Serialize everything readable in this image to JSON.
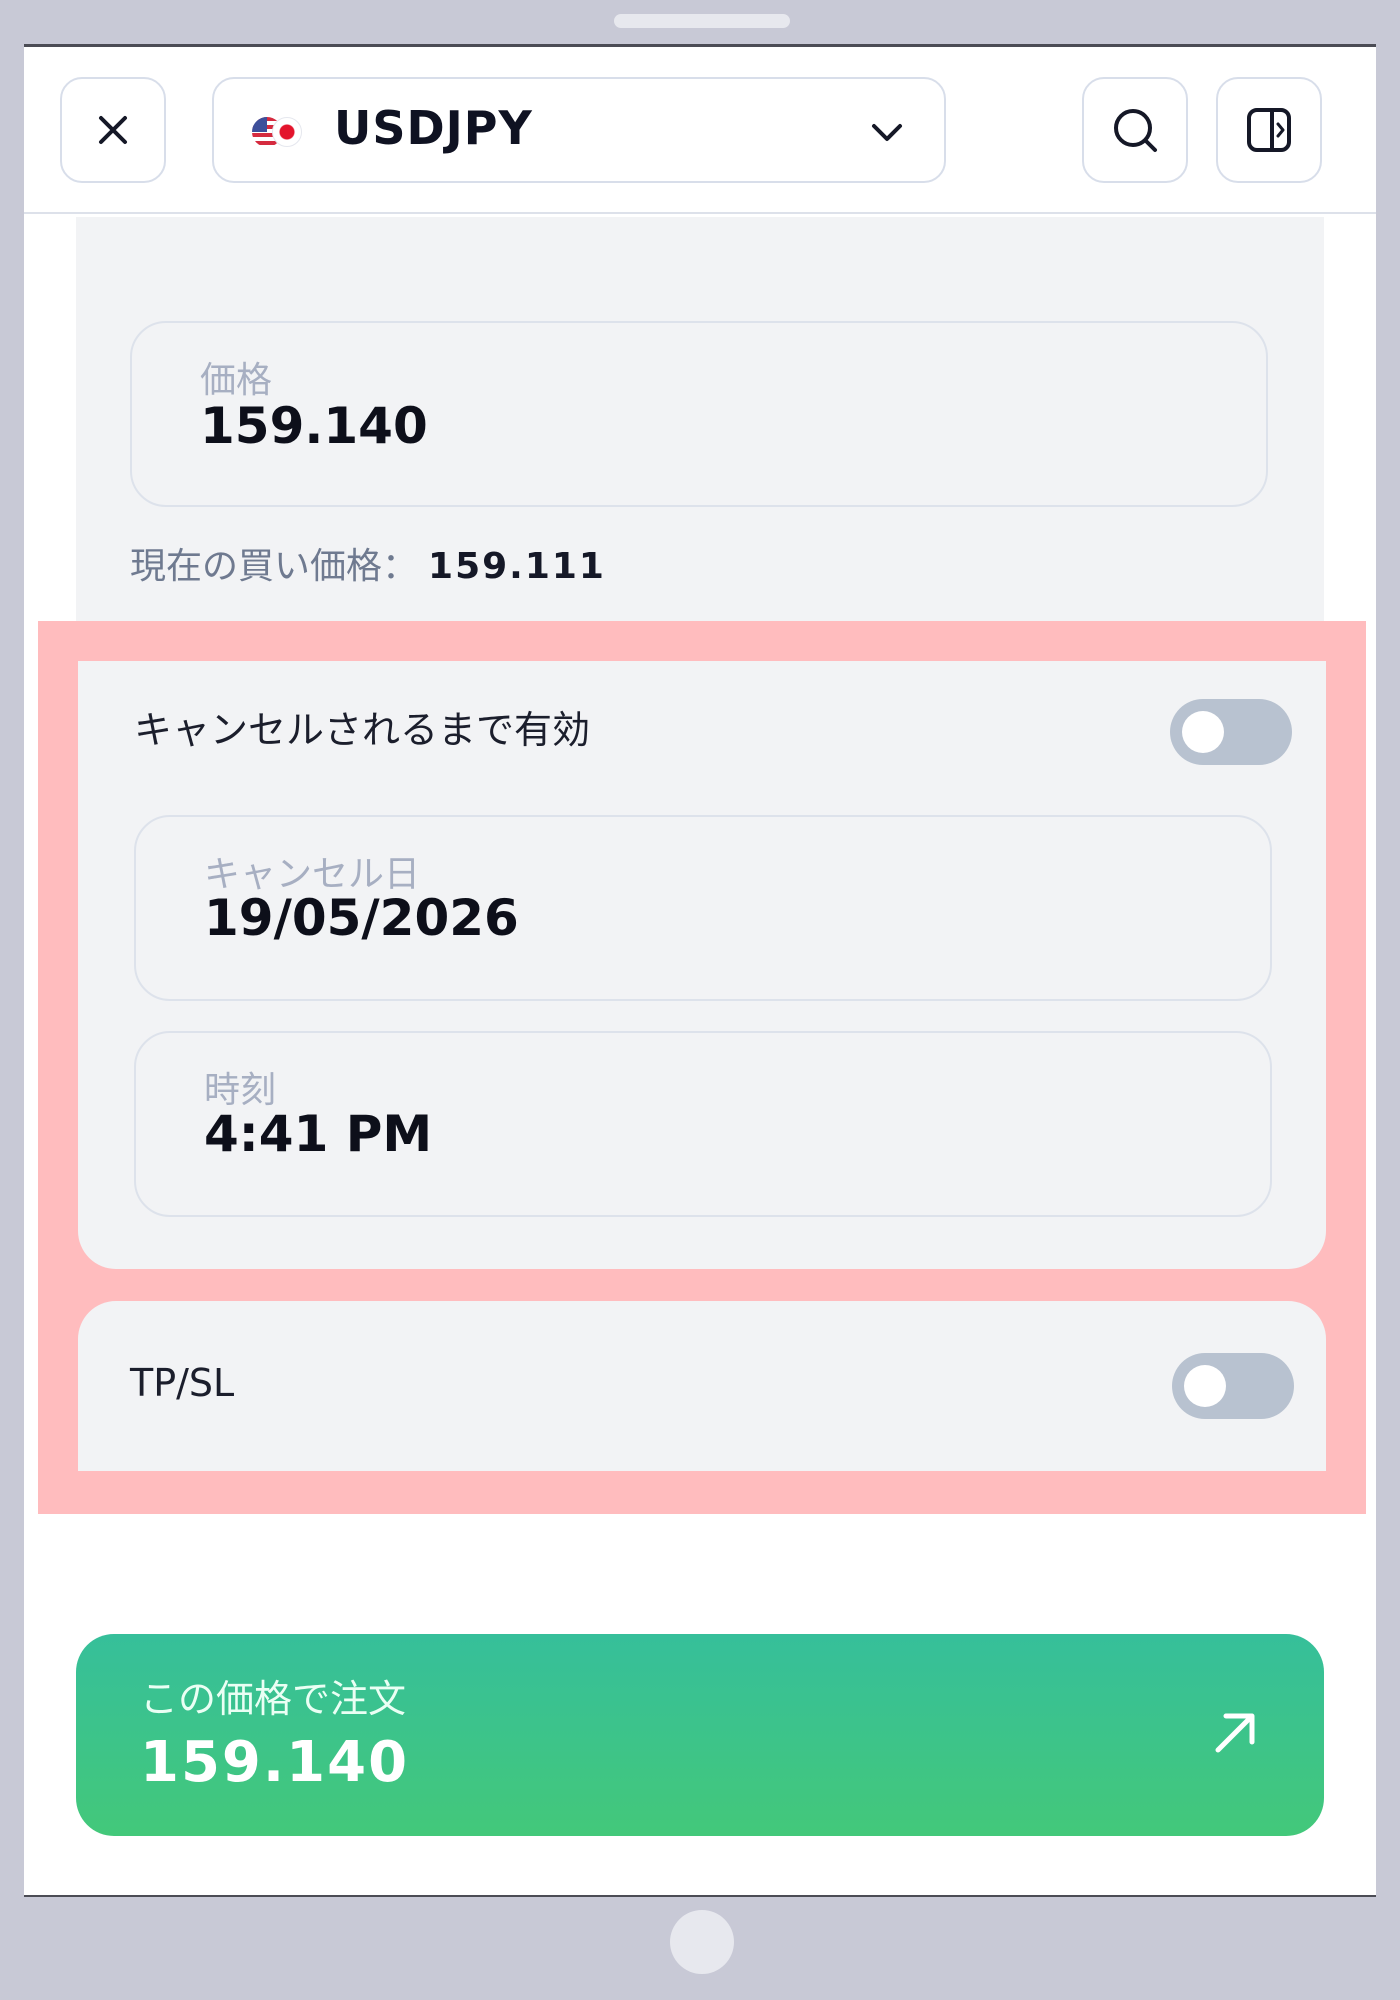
{
  "header": {
    "close_icon": "close-icon",
    "symbol": "USDJPY",
    "flags": [
      "us-flag-icon",
      "jp-flag-icon"
    ],
    "search_icon": "search-icon",
    "panel_icon": "side-panel-icon"
  },
  "price_field": {
    "label": "価格",
    "value": "159.140"
  },
  "current_buy": {
    "label": "現在の買い価格：",
    "value": "159.111"
  },
  "gtc": {
    "label": "キャンセルされるまで有効",
    "enabled": false
  },
  "cancel_date": {
    "label": "キャンセル日",
    "value": "19/05/2026"
  },
  "time": {
    "label": "時刻",
    "value": "4:41 PM"
  },
  "tpsl": {
    "label": "TP/SL",
    "enabled": false
  },
  "order_button": {
    "label": "この価格で注文",
    "price": "159.140",
    "icon": "arrow-up-right-icon"
  },
  "colors": {
    "accent_green": "#3ec58a",
    "highlight": "#ffbcbe",
    "toggle_off": "#b8c2d0"
  }
}
